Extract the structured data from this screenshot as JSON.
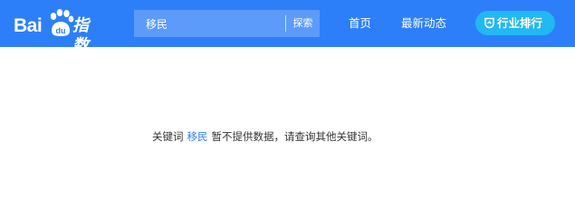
{
  "header": {
    "logo": {
      "part1": "Bai",
      "part2": "du",
      "part3": "指数"
    },
    "search": {
      "value": "移民",
      "button": "探索"
    },
    "nav": {
      "home": "首页",
      "news": "最新动态"
    },
    "ranking_button": "行业排行"
  },
  "main": {
    "message_prefix": "关键词",
    "keyword": "移民",
    "message_suffix": "暂不提供数据，请查询其他关键词。"
  },
  "colors": {
    "header_bg": "#2d7ff9",
    "search_bg": "#5c9bfa",
    "ranking_bg": "#21b8f3",
    "keyword": "#2d7ff9"
  }
}
